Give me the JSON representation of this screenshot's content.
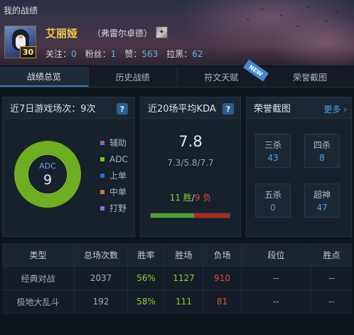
{
  "page_title": "我的战绩",
  "player": {
    "name": "艾丽娅",
    "server": "（弗雷尔卓德）",
    "level": "30",
    "follow_label": "关注：",
    "follow_value": "0",
    "fans_label": "粉丝：",
    "fans_value": "1",
    "likes_label": "赞：",
    "likes_value": "563",
    "block_label": "拉黑：",
    "block_value": "62"
  },
  "tabs": [
    {
      "label": "战绩总览",
      "active": true
    },
    {
      "label": "历史战绩",
      "active": false
    },
    {
      "label": "符文天赋",
      "active": false,
      "badge": "NEW"
    },
    {
      "label": "荣誉截图",
      "active": false
    }
  ],
  "recent_games": {
    "title": "近7日游戏场次：9次",
    "center_label": "ADC",
    "center_value": "9",
    "ring_color": "#7dbb22",
    "legend": [
      {
        "label": "辅助",
        "color": "#9a5fb1"
      },
      {
        "label": "ADC",
        "color": "#7dbb22"
      },
      {
        "label": "上单",
        "color": "#2f6fc8"
      },
      {
        "label": "中单",
        "color": "#e0732f"
      },
      {
        "label": "打野",
        "color": "#8a6fd6"
      }
    ]
  },
  "kda": {
    "title": "近20场平均KDA",
    "value": "7.8",
    "detail": "7.3/5.8/7.7",
    "wins_text": "11 胜",
    "separator": "/",
    "losses_text": "9 负",
    "wins": 11,
    "losses": 9
  },
  "honor": {
    "title": "荣誉截图",
    "more": "更多",
    "items": [
      {
        "label": "三杀",
        "value": "43"
      },
      {
        "label": "四杀",
        "value": "8"
      },
      {
        "label": "五杀",
        "value": "0"
      },
      {
        "label": "超神",
        "value": "47"
      }
    ]
  },
  "table": {
    "headers": [
      "类型",
      "总场次数",
      "胜率",
      "胜场",
      "负场",
      "段位",
      "胜点"
    ],
    "rows": [
      [
        "经典对战",
        "2037",
        "56%",
        "1127",
        "910",
        "--",
        "--"
      ],
      [
        "极地大乱斗",
        "192",
        "58%",
        "111",
        "81",
        "--",
        "--"
      ]
    ]
  }
}
